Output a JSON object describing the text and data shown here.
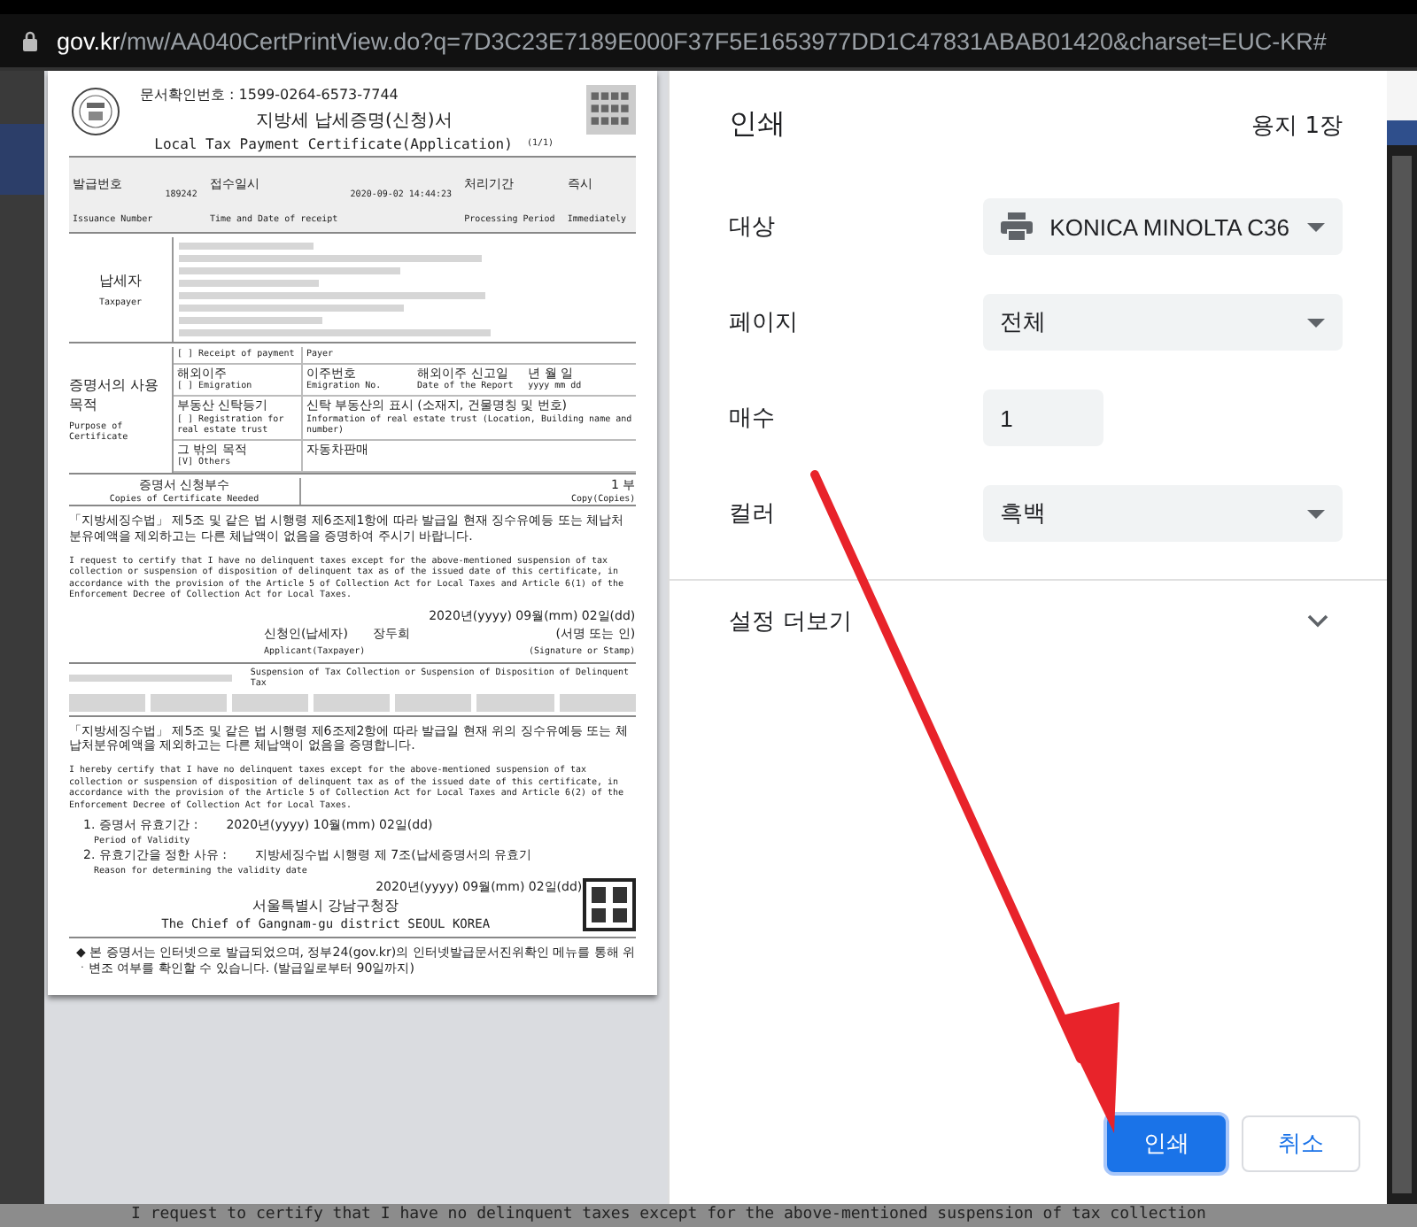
{
  "address_bar": {
    "host": "gov.kr",
    "path": "/mw/AA040CertPrintView.do?q=7D3C23E7189E000F37F5E1653977DD1C47831ABAB01420&charset=EUC-KR#"
  },
  "document": {
    "doc_number": "문서확인번호 : 1599-0264-6573-7744",
    "title_ko": "지방세 납세증명(신청)서",
    "title_en": "Local Tax Payment Certificate(Application)",
    "page": "(1/1)",
    "header": [
      {
        "ko": "발급번호",
        "en": "Issuance Number",
        "value": "189242"
      },
      {
        "ko": "접수일시",
        "en": "Time and Date of receipt",
        "value": "2020-09-02 14:44:23"
      },
      {
        "ko": "처리기간",
        "en": "Processing Period",
        "value_ko": "즉시",
        "value": "Immediately"
      }
    ],
    "taxpayer": {
      "ko": "납세자",
      "en": "Taxpayer"
    },
    "purpose": {
      "ko": "증명서의 사용 목적",
      "en": "Purpose of Certificate",
      "rows": [
        {
          "mark": "[ ]",
          "en": "Receipt of payment",
          "cells": [
            {
              "en": "Payer"
            }
          ]
        },
        {
          "mark": "[ ]",
          "ko": "해외이주",
          "en": "Emigration",
          "cells": [
            {
              "ko": "이주번호",
              "en": "Emigration No."
            },
            {
              "ko": "해외이주 신고일",
              "en": "Date of the Report"
            },
            {
              "ko": "년 월 일",
              "en": "yyyy mm dd"
            }
          ]
        },
        {
          "mark": "[ ]",
          "ko": "부동산 신탁등기",
          "en": "Registration for real estate trust",
          "cells": [
            {
              "ko": "신탁 부동산의 표시 (소재지, 건물명칭 및 번호)",
              "en": "Information of real estate trust (Location, Building name and number)"
            }
          ]
        },
        {
          "mark": "[V]",
          "ko": "그 밖의 목적",
          "en": "Others",
          "cells": [
            {
              "ko": "자동차판매"
            }
          ]
        }
      ]
    },
    "copies": {
      "ko": "증명서 신청부수",
      "en": "Copies of Certificate Needed",
      "value": "1 부",
      "unit": "Copy(Copies)"
    },
    "request_ko": "「지방세징수법」 제5조 및 같은 법 시행령 제6조제1항에 따라 발급일 현재 징수유예등 또는 체납처분유예액을 제외하고는 다른 체납액이 없음을 증명하여 주시기 바랍니다.",
    "request_en": "I request to certify that I have no delinquent taxes except for the above-mentioned suspension of tax collection or suspension of disposition of delinquent tax as of the issued date of this certificate, in accordance with the provision of the Article 5 of Collection Act for Local Taxes and Article 6(1) of the Enforcement Decree of Collection Act for Local Taxes.",
    "request_date": "2020년(yyyy) 09월(mm) 02일(dd)",
    "applicant_ko": "신청인(납세자)",
    "applicant_name": "장두희",
    "sign_ko": "(서명 또는 인)",
    "applicant_en": "Applicant(Taxpayer)",
    "sign_en": "(Signature or Stamp)",
    "suspension_en": "Suspension of Tax Collection or Suspension of Disposition of Delinquent Tax",
    "certify_ko": "「지방세징수법」 제5조 및 같은 법 시행령 제6조제2항에 따라 발급일 현재 위의 징수유예등 또는 체납처분유예액을 제외하고는 다른 체납액이 없음을 증명합니다.",
    "certify_en": "I hereby certify that I have no delinquent taxes except for the above-mentioned suspension of tax collection or suspension of disposition of delinquent tax as of the issued date of this certificate, in accordance with the provision of the Article 5 of Collection Act for Local Taxes and Article 6(2) of the Enforcement Decree of Collection Act for Local Taxes.",
    "items": [
      {
        "label_ko": "1. 증명서 유효기간 :",
        "value": "2020년(yyyy) 10월(mm) 02일(dd)",
        "label_en": "Period of Validity"
      },
      {
        "label_ko": "2. 유효기간을 정한 사유 :",
        "value": "지방세징수법 시행령 제 7조(납세증명서의 유효기",
        "label_en": "Reason for determining the validity date"
      }
    ],
    "issue_date": "2020년(yyyy) 09월(mm) 02일(dd)",
    "issuer_ko": "서울특별시 강남구청장",
    "issuer_en": "The Chief of Gangnam-gu district SEOUL KOREA",
    "footnote": "◆ 본 증명서는 인터넷으로 발급되었으며, 정부24(gov.kr)의 인터넷발급문서진위확인 메뉴를 통해 위ㆍ변조 여부를 확인할 수 있습니다. (발급일로부터 90일까지)"
  },
  "print_panel": {
    "title": "인쇄",
    "sheets": "용지 1장",
    "settings": [
      {
        "kind": "printer",
        "label": "대상",
        "value": "KONICA MINOLTA C36"
      },
      {
        "kind": "select",
        "label": "페이지",
        "value": "전체"
      },
      {
        "kind": "number",
        "label": "매수",
        "value": "1"
      },
      {
        "kind": "select",
        "label": "컬러",
        "value": "흑백"
      }
    ],
    "more": {
      "label": "설정 더보기",
      "expanded": false
    },
    "buttons": [
      {
        "label": "인쇄",
        "primary": true
      },
      {
        "label": "취소",
        "primary": false
      }
    ]
  },
  "background_text": "I request to certify that I have no delinquent taxes except for the above-mentioned suspension of tax collection"
}
